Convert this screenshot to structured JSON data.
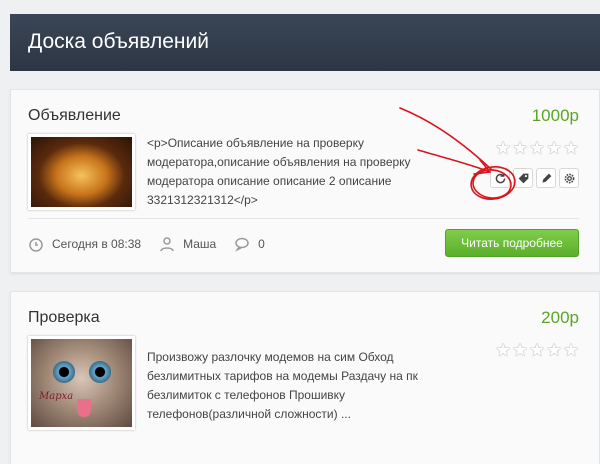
{
  "header": {
    "title": "Доска объявлений"
  },
  "listings": [
    {
      "title": "Объявление",
      "price": "1000р",
      "description": "<p>Описание объявление на проверку модератора,описание объявления на проверку модератора описание описание 2 описание 3321312321312</p>",
      "date": "Сегодня в 08:38",
      "author": "Маша",
      "comments": "0",
      "read_more": "Читать подробнее"
    },
    {
      "title": "Проверка",
      "price": "200р",
      "description": "Произвожу разлочку модемов на сим Обход безлимитных тарифов на модемы Раздачу на пк безлимиток с телефонов Прошивку телефонов(различной сложности) ...",
      "image_caption": "Марха"
    }
  ],
  "colors": {
    "header_bg": "#2f3947",
    "price": "#5aa526",
    "button": "#6cbd38",
    "annotation": "#d8141c"
  }
}
